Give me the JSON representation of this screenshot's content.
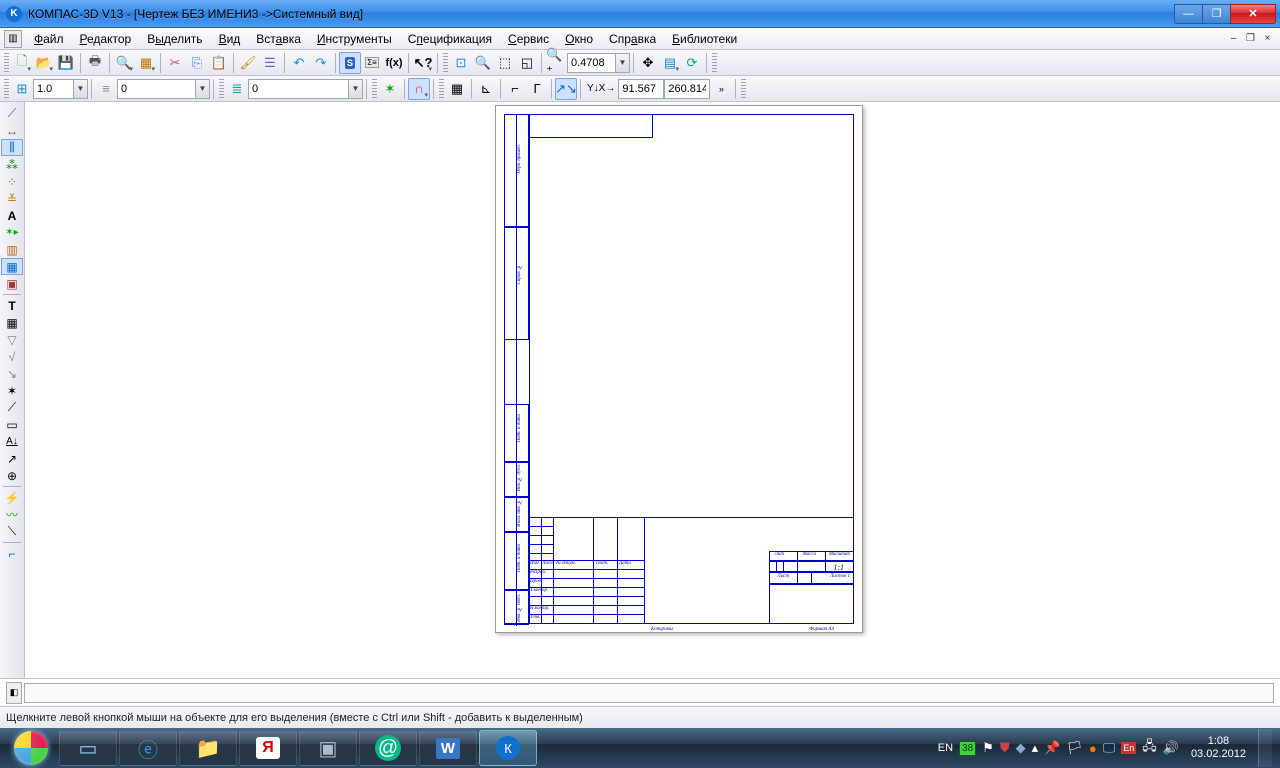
{
  "title": "КОМПАС-3D V13 - [Чертеж БЕЗ ИМЕНИ3 ->Системный вид]",
  "menu": {
    "file": "Файл",
    "edit": "Редактор",
    "select": "Выделить",
    "view": "Вид",
    "insert": "Вставка",
    "tools": "Инструменты",
    "spec": "Спецификация",
    "service": "Сервис",
    "window": "Окно",
    "help": "Справка",
    "libs": "Библиотеки"
  },
  "tb1": {
    "zoom_val": "0.4708"
  },
  "tb2": {
    "step_val": "1.0",
    "layer_val": "0",
    "style_val": "0",
    "coord_x": "91.567",
    "coord_y": "260.814",
    "xy_label": "Y↓X→"
  },
  "drawing": {
    "lit": "Лит",
    "massa": "Масса",
    "mashtab": "Масштаб",
    "scale": "1:1",
    "list": "Лист",
    "listov": "Листов     1",
    "izm": "Изм",
    "list2": "Лист",
    "ndokum": "№ докум.",
    "podp": "Подп.",
    "data": "Дата",
    "razrab": "Разраб.",
    "prov": "Пров.",
    "tkontr": "Т.контр.",
    "nkontr": "Н.контр.",
    "utv": "Утв.",
    "kopiroval": "Копировал",
    "format": "Формат    A4",
    "side1": "Перв. примен.",
    "side2": "Справ. №",
    "side3": "Подп. и дата",
    "side4": "Инв. № дубл.",
    "side5": "Взам. инв. №",
    "side6": "Подп. и дата",
    "side7": "Инв. № подл."
  },
  "status": "Щелкните левой кнопкой мыши на объекте для его выделения (вместе с Ctrl или Shift - добавить к выделенным)",
  "tray": {
    "lang": "EN",
    "ic38": "38",
    "time": "1:08",
    "date": "03.02.2012"
  }
}
